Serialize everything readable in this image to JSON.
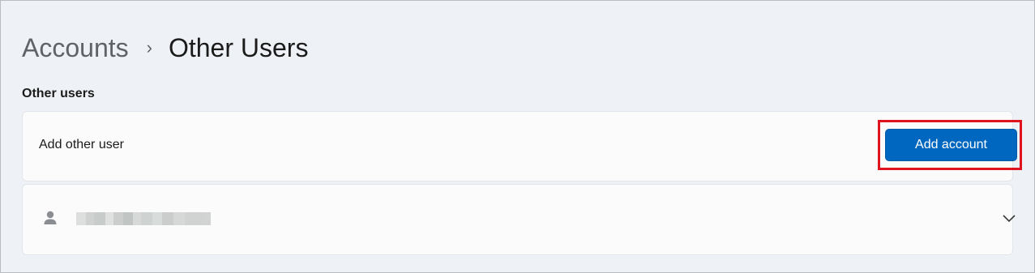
{
  "breadcrumb": {
    "parent": "Accounts",
    "separator": "›",
    "current": "Other Users"
  },
  "section": {
    "title": "Other users"
  },
  "add_user_card": {
    "label": "Add other user",
    "button_label": "Add account"
  },
  "user_card": {
    "icon": "person-icon",
    "expand_icon": "chevron-down-icon"
  },
  "colors": {
    "accent": "#0067c0",
    "highlight": "#e0141e"
  }
}
